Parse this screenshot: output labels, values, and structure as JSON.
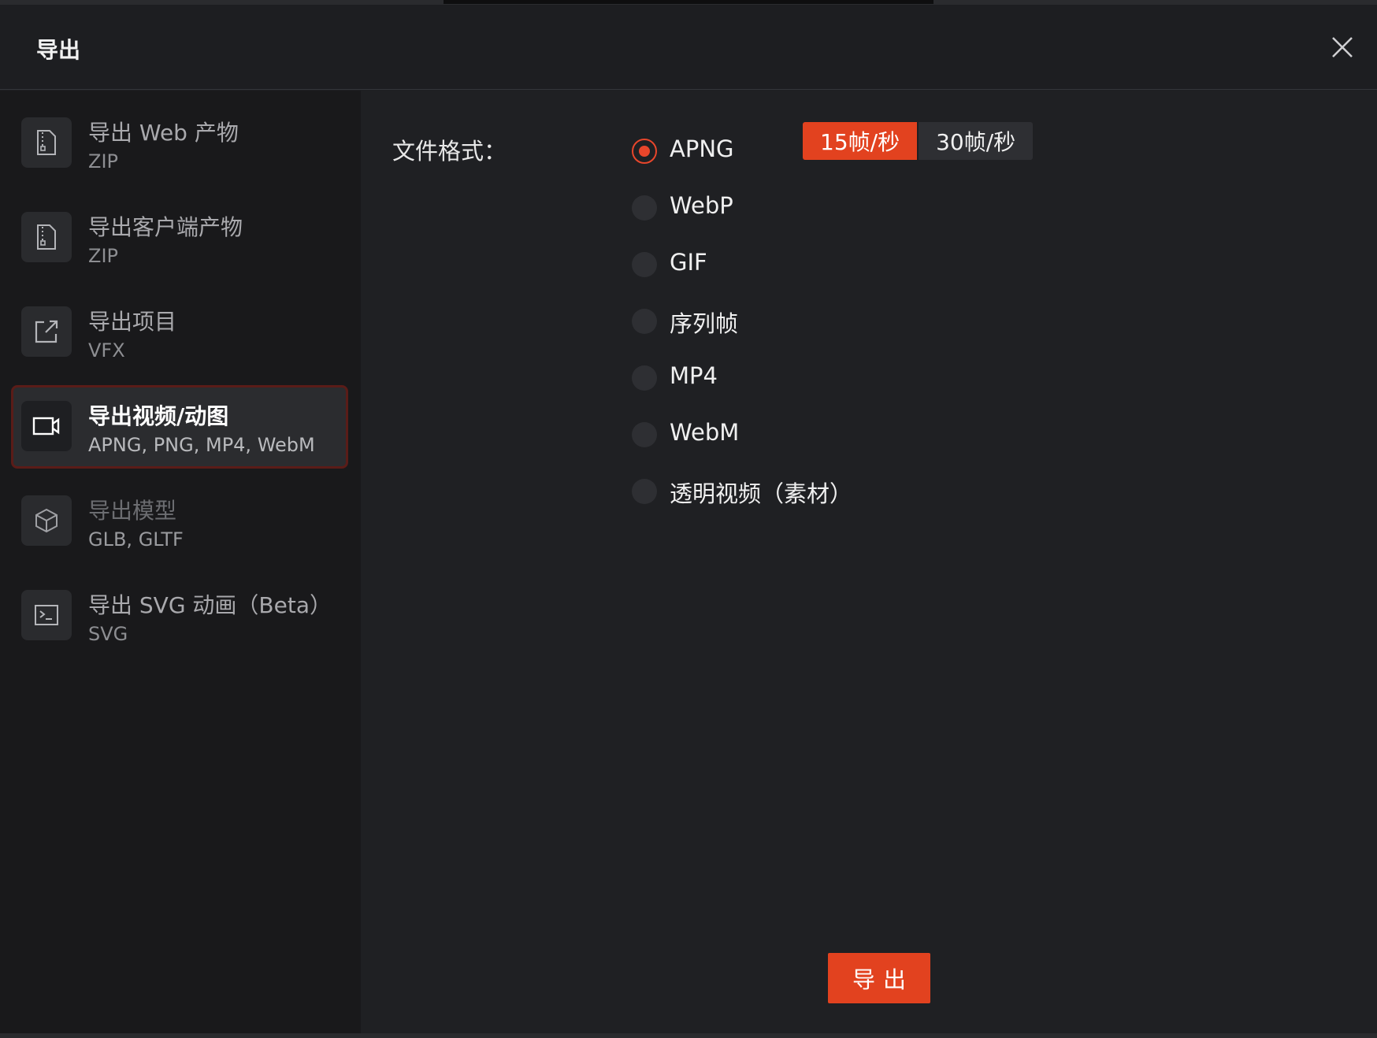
{
  "dialog": {
    "title": "导出",
    "close_icon": "close-icon"
  },
  "sidebar": {
    "items": [
      {
        "title": "导出 Web 产物",
        "sub": "ZIP",
        "icon": "zip-file-icon",
        "state": "normal"
      },
      {
        "title": "导出客户端产物",
        "sub": "ZIP",
        "icon": "zip-file-icon",
        "state": "normal"
      },
      {
        "title": "导出项目",
        "sub": "VFX",
        "icon": "external-link-icon",
        "state": "normal"
      },
      {
        "title": "导出视频/动图",
        "sub": "APNG, PNG, MP4, WebM",
        "icon": "video-camera-icon",
        "state": "active"
      },
      {
        "title": "导出模型",
        "sub": "GLB, GLTF",
        "icon": "cube-icon",
        "state": "disabled"
      },
      {
        "title": "导出 SVG 动画（Beta）",
        "sub": "SVG",
        "icon": "terminal-icon",
        "state": "normal"
      }
    ]
  },
  "main": {
    "format_label": "文件格式：",
    "formats": [
      {
        "label": "APNG",
        "checked": true
      },
      {
        "label": "WebP",
        "checked": false
      },
      {
        "label": "GIF",
        "checked": false
      },
      {
        "label": "序列帧",
        "checked": false
      },
      {
        "label": "MP4",
        "checked": false
      },
      {
        "label": "WebM",
        "checked": false
      },
      {
        "label": "透明视频（素材）",
        "checked": false
      }
    ],
    "fps_options": [
      {
        "label": "15帧/秒",
        "active": true
      },
      {
        "label": "30帧/秒",
        "active": false
      }
    ],
    "export_label": "导出"
  },
  "colors": {
    "accent": "#e2421f",
    "active_border": "#5a1c18"
  }
}
